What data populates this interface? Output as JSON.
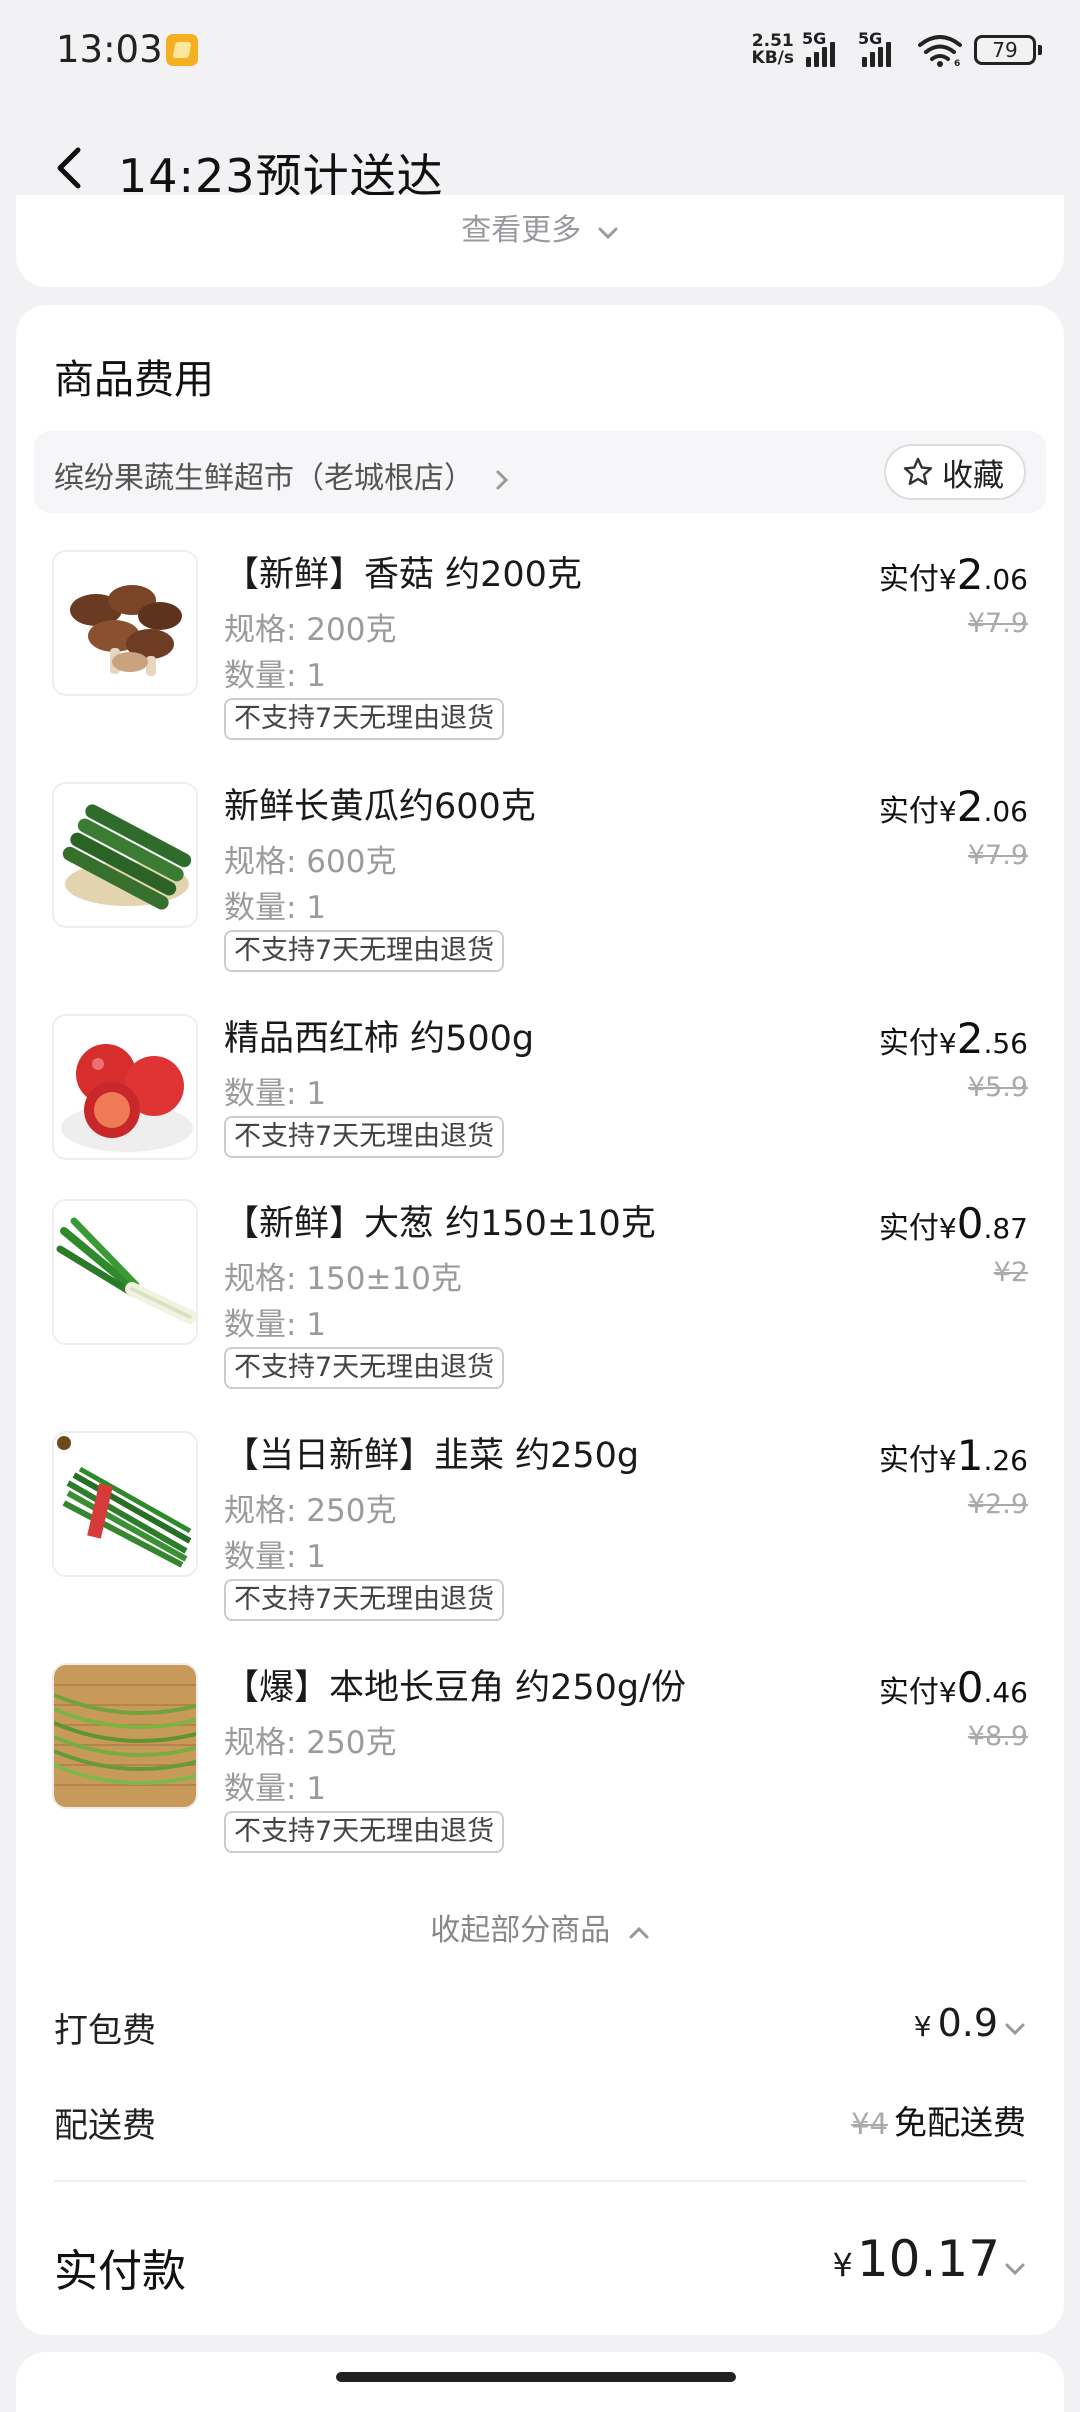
{
  "status_bar": {
    "time": "13:03",
    "net_speed_top": "2.51",
    "net_speed_bottom": "KB/s",
    "sim1": "5G",
    "sim2": "5G",
    "wifi_sub": "6",
    "battery": "79"
  },
  "nav": {
    "title": "14:23预计送达"
  },
  "top_card": {
    "see_more": "查看更多"
  },
  "fees_section": {
    "title": "商品费用",
    "store_name": "缤纷果蔬生鲜超市（老城根店）",
    "favorite_label": "收藏",
    "items": [
      {
        "name": "【新鲜】香菇 约200克",
        "spec": "规格: 200克",
        "qty": "数量: 1",
        "tag": "不支持7天无理由退货",
        "paid_label": "实付",
        "currency": "¥",
        "price_int": "2",
        "price_dec": ".06",
        "orig": "¥7.9",
        "image": "mushroom-image"
      },
      {
        "name": "新鲜长黄瓜约600克",
        "spec": "规格: 600克",
        "qty": "数量: 1",
        "tag": "不支持7天无理由退货",
        "paid_label": "实付",
        "currency": "¥",
        "price_int": "2",
        "price_dec": ".06",
        "orig": "¥7.9",
        "image": "cucumber-image"
      },
      {
        "name": "精品西红柿 约500g",
        "qty": "数量: 1",
        "tag": "不支持7天无理由退货",
        "paid_label": "实付",
        "currency": "¥",
        "price_int": "2",
        "price_dec": ".56",
        "orig": "¥5.9",
        "image": "tomato-image"
      },
      {
        "name": "【新鲜】大葱 约150±10克",
        "spec": "规格: 150±10克",
        "qty": "数量: 1",
        "tag": "不支持7天无理由退货",
        "paid_label": "实付",
        "currency": "¥",
        "price_int": "0",
        "price_dec": ".87",
        "orig": "¥2",
        "image": "scallion-image"
      },
      {
        "name": "【当日新鲜】韭菜 约250g",
        "spec": "规格: 250克",
        "qty": "数量: 1",
        "tag": "不支持7天无理由退货",
        "paid_label": "实付",
        "currency": "¥",
        "price_int": "1",
        "price_dec": ".26",
        "orig": "¥2.9",
        "image": "chives-image"
      },
      {
        "name": "【爆】本地长豆角 约250g/份",
        "spec": "规格: 250克",
        "qty": "数量: 1",
        "tag": "不支持7天无理由退货",
        "paid_label": "实付",
        "currency": "¥",
        "price_int": "0",
        "price_dec": ".46",
        "orig": "¥8.9",
        "image": "long-bean-image"
      }
    ],
    "collapse_label": "收起部分商品",
    "packing_fee": {
      "label": "打包费",
      "currency": "¥",
      "value": "0.9"
    },
    "delivery_fee": {
      "label": "配送费",
      "orig": "¥4",
      "value": "免配送费"
    },
    "total": {
      "label": "实付款",
      "currency": "¥",
      "value": "10.17"
    }
  },
  "colors": {
    "background": "#f2f2f4",
    "card": "#ffffff",
    "muted_text": "#9b9b9b",
    "accent_badge": "#f5b021"
  }
}
